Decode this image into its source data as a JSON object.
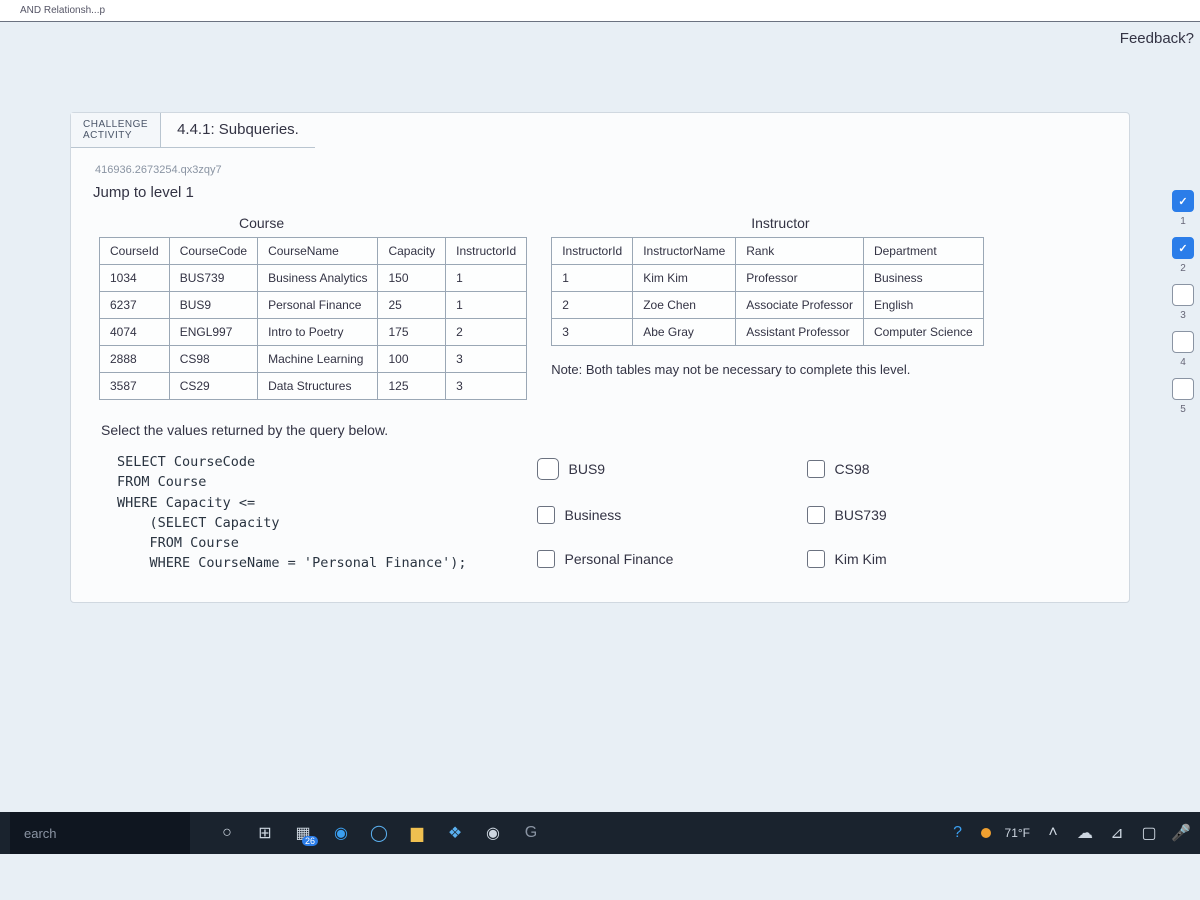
{
  "crumb": "AND Relationsh...p",
  "feedback_label": "Feedback?",
  "activity": {
    "badge1": "CHALLENGE",
    "badge2": "ACTIVITY",
    "title": "4.4.1: Subqueries."
  },
  "hash": "416936.2673254.qx3zqy7",
  "jump": "Jump to level 1",
  "course_table": {
    "title": "Course",
    "headers": [
      "CourseId",
      "CourseCode",
      "CourseName",
      "Capacity",
      "InstructorId"
    ],
    "rows": [
      [
        "1034",
        "BUS739",
        "Business Analytics",
        "150",
        "1"
      ],
      [
        "6237",
        "BUS9",
        "Personal Finance",
        "25",
        "1"
      ],
      [
        "4074",
        "ENGL997",
        "Intro to Poetry",
        "175",
        "2"
      ],
      [
        "2888",
        "CS98",
        "Machine Learning",
        "100",
        "3"
      ],
      [
        "3587",
        "CS29",
        "Data Structures",
        "125",
        "3"
      ]
    ]
  },
  "instructor_table": {
    "title": "Instructor",
    "headers": [
      "InstructorId",
      "InstructorName",
      "Rank",
      "Department"
    ],
    "rows": [
      [
        "1",
        "Kim Kim",
        "Professor",
        "Business"
      ],
      [
        "2",
        "Zoe Chen",
        "Associate Professor",
        "English"
      ],
      [
        "3",
        "Abe Gray",
        "Assistant Professor",
        "Computer Science"
      ]
    ]
  },
  "note": "Note: Both tables may not be necessary to complete this level.",
  "prompt": "Select the values returned by the query below.",
  "sql": {
    "l1": "SELECT CourseCode",
    "l2": "FROM Course",
    "l3": "WHERE Capacity <=",
    "l4": "    (SELECT Capacity",
    "l5": "    FROM Course",
    "l6": "    WHERE CourseName = 'Personal Finance');"
  },
  "options": [
    "BUS9",
    "CS98",
    "Business",
    "BUS739",
    "Personal Finance",
    "Kim Kim"
  ],
  "steps": [
    "1",
    "2",
    "3",
    "4",
    "5"
  ],
  "taskbar": {
    "search_placeholder": "earch",
    "temp": "71°F"
  }
}
